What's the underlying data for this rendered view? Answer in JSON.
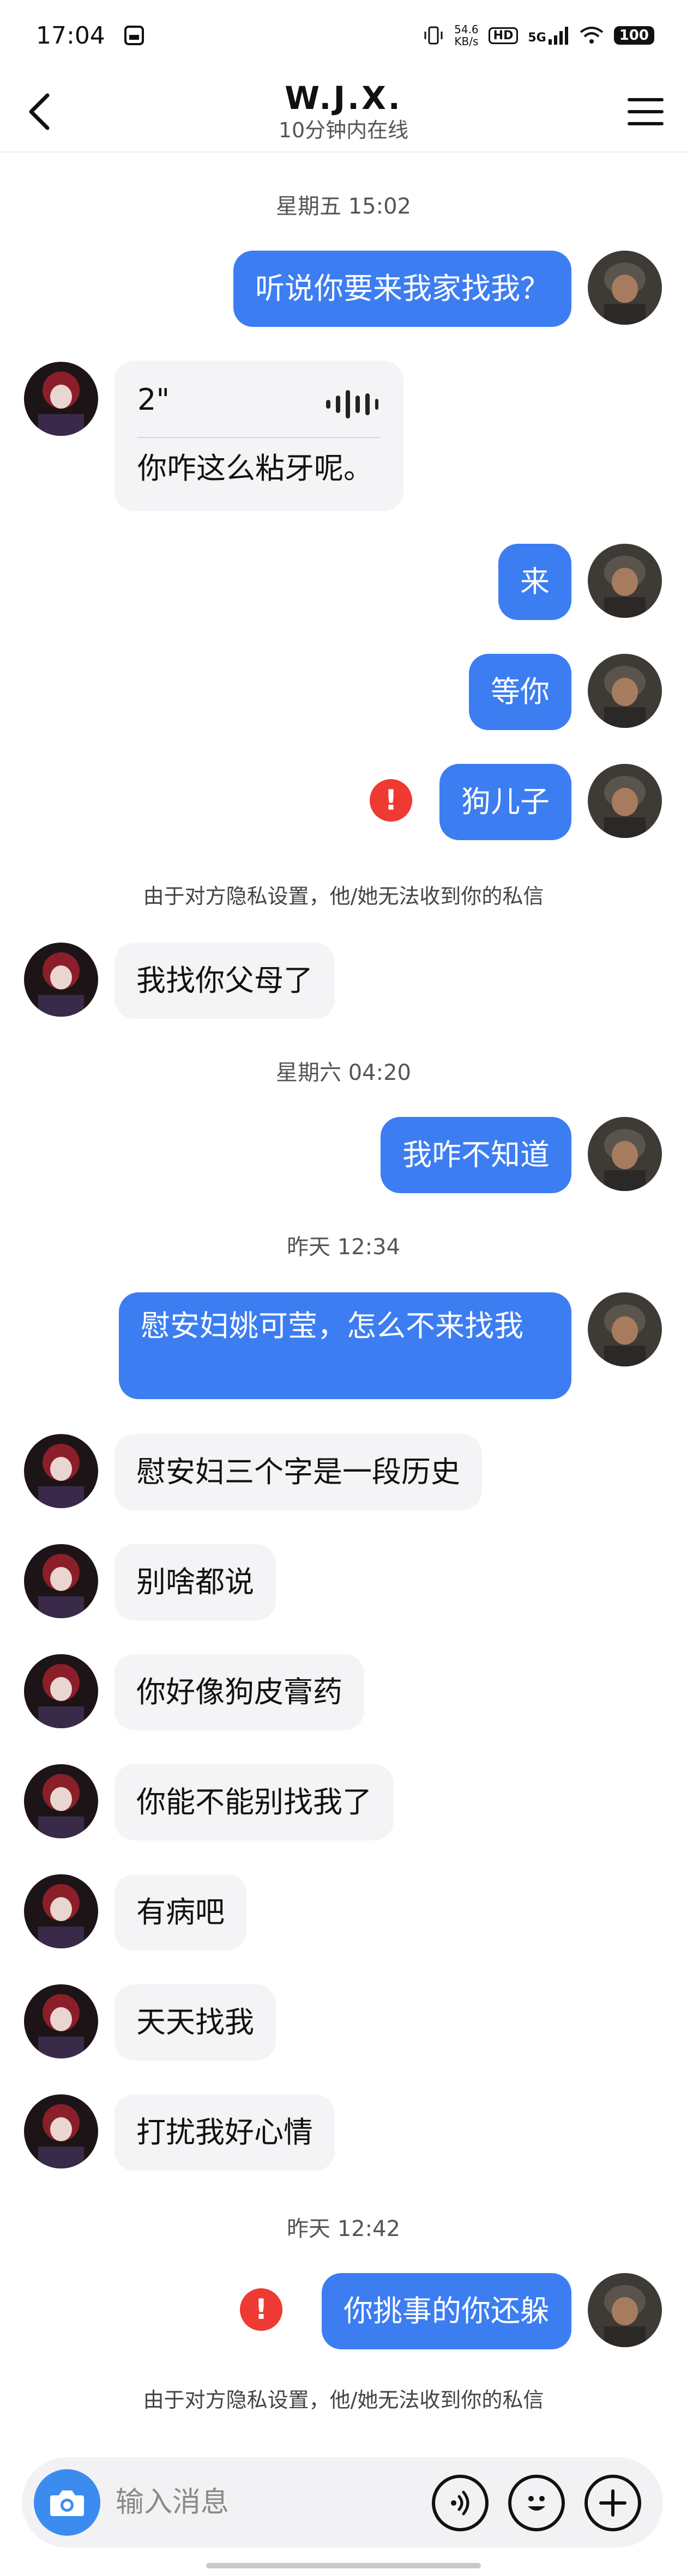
{
  "status_bar": {
    "time": "17:04",
    "net_speed_value": "54.6",
    "net_speed_unit": "KB/s",
    "hd": "HD",
    "network": "5G",
    "battery": "100"
  },
  "header": {
    "title": "W.J.X.",
    "subtitle": "10分钟内在线"
  },
  "messages": {
    "t1": "星期五 15:02",
    "m1": "听说你要来我家找我？",
    "voice_duration": "2\"",
    "voice_text": "你咋这么粘牙呢。",
    "m3": "来",
    "m4": "等你",
    "m5": "狗儿子",
    "notice1": "由于对方隐私设置，他/她无法收到你的私信",
    "m6": "我找你父母了",
    "t2": "星期六 04:20",
    "m7": "我咋不知道",
    "t3": "昨天 12:34",
    "m8": "慰安妇姚可莹，怎么不来找我",
    "m9": "慰安妇三个字是一段历史",
    "m10": "别啥都说",
    "m11": "你好像狗皮膏药",
    "m12": "你能不能别找我了",
    "m13": "有病吧",
    "m14": "天天找我",
    "m15": "打扰我好心情",
    "t4": "昨天 12:42",
    "m16": "你挑事的你还躲",
    "notice2": "由于对方隐私设置，他/她无法收到你的私信"
  },
  "input_bar": {
    "placeholder": "输入消息"
  },
  "colors": {
    "my_bubble": "#3c7df2",
    "their_bubble": "#f4f4f6",
    "error": "#ee3a32",
    "camera": "#3c8cf0"
  },
  "icons": [
    "back-icon",
    "menu-icon",
    "error-icon",
    "voice-wave-icon",
    "camera-icon",
    "voice-input-icon",
    "emoji-icon",
    "plus-icon"
  ]
}
